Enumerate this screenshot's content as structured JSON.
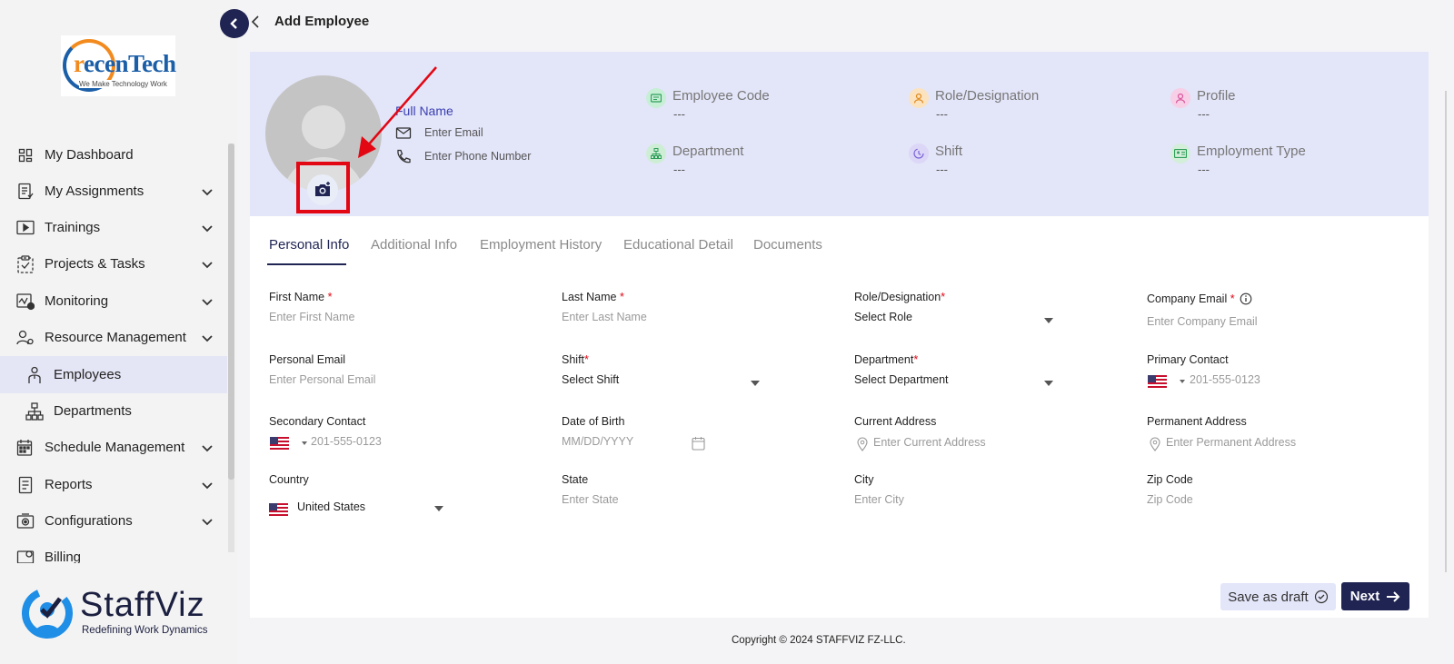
{
  "brand_top": {
    "name_prefix": "r",
    "name_rest": "ecenTech",
    "tagline": "We Make Technology Work"
  },
  "sidebar": {
    "items": [
      {
        "label": "My Dashboard",
        "icon": "dashboard-icon",
        "expandable": false
      },
      {
        "label": "My Assignments",
        "icon": "assignments-icon",
        "expandable": true
      },
      {
        "label": "Trainings",
        "icon": "trainings-icon",
        "expandable": true
      },
      {
        "label": "Projects & Tasks",
        "icon": "clipboard-icon",
        "expandable": true
      },
      {
        "label": "Monitoring",
        "icon": "monitoring-icon",
        "expandable": true
      },
      {
        "label": "Resource Management",
        "icon": "resource-management-icon",
        "expandable": true
      },
      {
        "label": "Employees",
        "icon": "employees-icon",
        "sub": true,
        "active": true
      },
      {
        "label": "Departments",
        "icon": "departments-icon",
        "sub": true
      },
      {
        "label": "Schedule Management",
        "icon": "schedule-icon",
        "expandable": true
      },
      {
        "label": "Reports",
        "icon": "reports-icon",
        "expandable": true
      },
      {
        "label": "Configurations",
        "icon": "configurations-icon",
        "expandable": true
      },
      {
        "label": "Billing",
        "icon": "billing-icon",
        "expandable": false
      }
    ]
  },
  "brand_bottom": {
    "name": "StaffViz",
    "tagline": "Redefining Work Dynamics"
  },
  "header": {
    "title": "Add Employee"
  },
  "profile": {
    "full_name": "Full Name",
    "email_placeholder": "Enter Email",
    "phone_placeholder": "Enter Phone Number",
    "fields": [
      {
        "key": "Employee Code",
        "value": "---",
        "icon": "employee-code-icon",
        "color": "#c6efd6"
      },
      {
        "key": "Role/Designation",
        "value": "---",
        "icon": "role-icon",
        "color": "#fbe3bf"
      },
      {
        "key": "Profile",
        "value": "---",
        "icon": "profile-icon",
        "color": "#f7cfe6"
      },
      {
        "key": "Department",
        "value": "---",
        "icon": "department-icon",
        "color": "#cdeed4"
      },
      {
        "key": "Shift",
        "value": "---",
        "icon": "shift-icon",
        "color": "#dcd6f7"
      },
      {
        "key": "Employment Type",
        "value": "---",
        "icon": "employment-type-icon",
        "color": "#d3eed9"
      }
    ]
  },
  "tabs": [
    "Personal Info",
    "Additional Info",
    "Employment History",
    "Educational Detail",
    "Documents"
  ],
  "form": {
    "first_name": {
      "label": "First Name",
      "req": "*",
      "placeholder": "Enter First Name"
    },
    "last_name": {
      "label": "Last Name",
      "req": "*",
      "placeholder": "Enter Last Name"
    },
    "role": {
      "label": "Role/Designation",
      "req": "*",
      "value": "Select Role"
    },
    "company_email": {
      "label": "Company Email",
      "req": "*",
      "placeholder": "Enter Company Email"
    },
    "personal_email": {
      "label": "Personal Email",
      "placeholder": "Enter Personal Email"
    },
    "shift": {
      "label": "Shift",
      "req": "*",
      "value": "Select Shift"
    },
    "department": {
      "label": "Department",
      "req": "*",
      "value": "Select Department"
    },
    "primary_contact": {
      "label": "Primary Contact",
      "placeholder": "201-555-0123"
    },
    "secondary_contact": {
      "label": "Secondary Contact",
      "placeholder": "201-555-0123"
    },
    "dob": {
      "label": "Date of Birth",
      "placeholder": "MM/DD/YYYY"
    },
    "current_address": {
      "label": "Current Address",
      "placeholder": "Enter Current Address"
    },
    "permanent_address": {
      "label": "Permanent Address",
      "placeholder": "Enter Permanent Address"
    },
    "country": {
      "label": "Country",
      "value": "United States"
    },
    "state": {
      "label": "State",
      "placeholder": "Enter State"
    },
    "city": {
      "label": "City",
      "placeholder": "Enter City"
    },
    "zip": {
      "label": "Zip Code",
      "placeholder": "Zip Code"
    }
  },
  "actions": {
    "save_draft": "Save as draft",
    "next": "Next"
  },
  "footer": {
    "copyright": "Copyright © 2024 STAFFVIZ FZ-LLC."
  },
  "colors": {
    "primary": "#1f2452",
    "band": "#e3e5f9",
    "required": "#e30613",
    "annotation": "#e30613"
  }
}
